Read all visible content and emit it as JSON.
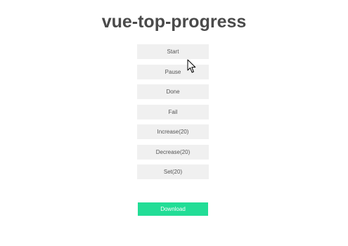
{
  "page": {
    "title": "vue-top-progress"
  },
  "controls": [
    {
      "label": "Start"
    },
    {
      "label": "Pause"
    },
    {
      "label": "Done"
    },
    {
      "label": "Fail"
    },
    {
      "label": "Increase(20)"
    },
    {
      "label": "Decrease(20)"
    },
    {
      "label": "Set(20)"
    }
  ],
  "download": {
    "label": "Download",
    "color": "#22dd96"
  },
  "icons": {
    "cursor": "mouse-pointer-icon"
  }
}
